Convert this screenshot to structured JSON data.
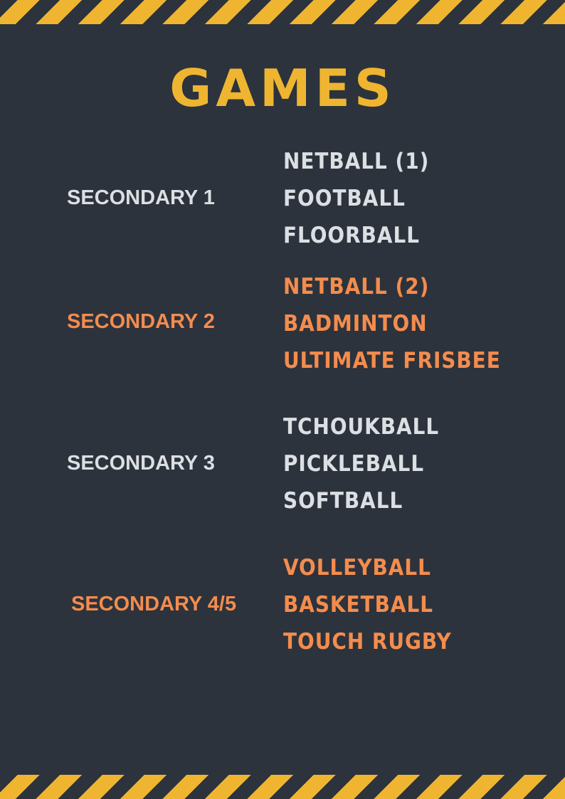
{
  "title": "GAMES",
  "colors": {
    "background": "#2c333c",
    "accent_yellow": "#efb531",
    "accent_orange": "#f48c4e",
    "text_light": "#dcdfe3"
  },
  "groups": [
    {
      "label": "SECONDARY 1",
      "color": "light",
      "sports": [
        "NETBALL (1)",
        "FOOTBALL",
        "FLOORBALL"
      ]
    },
    {
      "label": "SECONDARY 2",
      "color": "orange",
      "sports": [
        "NETBALL (2)",
        "BADMINTON",
        "ULTIMATE FRISBEE"
      ]
    },
    {
      "label": "SECONDARY 3",
      "color": "light",
      "sports": [
        "TCHOUKBALL",
        "PICKLEBALL",
        "SOFTBALL"
      ]
    },
    {
      "label": "SECONDARY 4/5",
      "color": "orange",
      "sports": [
        "VOLLEYBALL",
        "BASKETBALL",
        "TOUCH RUGBY"
      ]
    }
  ]
}
